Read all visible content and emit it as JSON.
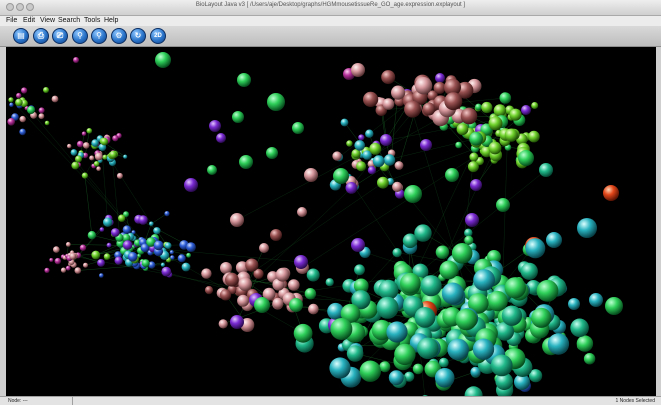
{
  "window": {
    "title": "BioLayout Java v3  [ /Users/aje/Desktop/graphs/HGMmousetissueRe_GO_age.expression.explayout ]"
  },
  "menu": [
    "File",
    "Edit",
    "View",
    "Search",
    "Tools",
    "Help"
  ],
  "toolbar": [
    {
      "name": "open-file-icon",
      "glyph": "▤"
    },
    {
      "name": "save-icon",
      "glyph": "⎙"
    },
    {
      "name": "print-icon",
      "glyph": "⎚"
    },
    {
      "name": "zoom-icon",
      "glyph": "⚲"
    },
    {
      "name": "zoom-out-icon",
      "glyph": "⚲"
    },
    {
      "name": "settings-icon",
      "glyph": "⚙"
    },
    {
      "name": "rotate-icon",
      "glyph": "↻"
    },
    {
      "name": "view-2d-icon",
      "glyph": "2D"
    }
  ],
  "status": {
    "left": "Node: ---",
    "right": "1 Nodes Selected"
  },
  "colors": {
    "background": "#000000",
    "edge": "#1f7a2f",
    "green": "#2fd05a",
    "teal": "#26c38a",
    "pink": "#e0a0a6",
    "purple": "#7a2bd2",
    "orange": "#e2471a",
    "blue": "#2f5fd8",
    "cyan": "#29c7d0"
  }
}
